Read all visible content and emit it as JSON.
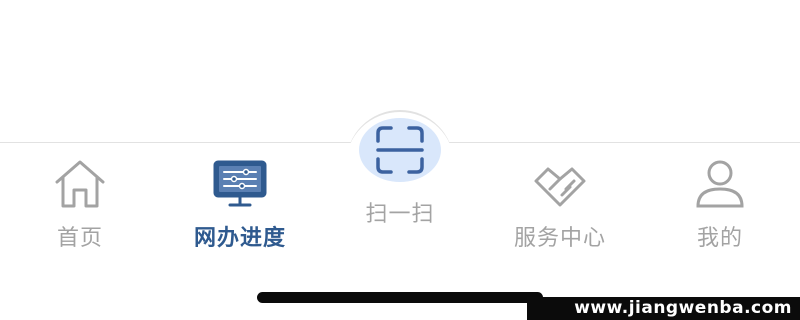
{
  "tabbar": {
    "tabs": [
      {
        "label": "首页",
        "icon": "home-icon",
        "active": false
      },
      {
        "label": "网办进度",
        "icon": "monitor-settings-icon",
        "active": true
      },
      {
        "label": "扫一扫",
        "icon": "scan-icon",
        "active": false
      },
      {
        "label": "服务中心",
        "icon": "handshake-heart-icon",
        "active": false
      },
      {
        "label": "我的",
        "icon": "user-icon",
        "active": false
      }
    ]
  },
  "colors": {
    "active": "#2f5a8f",
    "inactive": "#a3a3a3",
    "scan_bg": "#d9e7fb",
    "scan_icon": "#3c62a0"
  },
  "watermark": "www.jiangwenba.com"
}
